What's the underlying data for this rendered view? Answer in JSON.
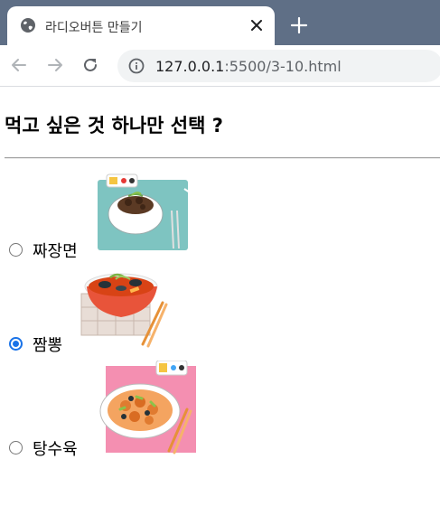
{
  "browser": {
    "tab_title": "라디오버튼 만들기",
    "url_host": "127.0.0.1",
    "url_rest": ":5500/3-10.html"
  },
  "page": {
    "heading": "먹고 싶은 것 하나만 선택 ?",
    "options": [
      {
        "label": "짜장면",
        "checked": false,
        "image_icon": "jajangmyeon-image"
      },
      {
        "label": "짬뽕",
        "checked": true,
        "image_icon": "jjamppong-image"
      },
      {
        "label": "탕수육",
        "checked": false,
        "image_icon": "tangsuyuk-image"
      }
    ]
  },
  "colors": {
    "tabstrip": "#5f6f86",
    "radio_checked": "#1a73e8",
    "jajangmyeon_mat": "#7ec4c1",
    "tangsuyuk_mat": "#f48fb1",
    "jjamppong_bowl": "#e8543a"
  }
}
